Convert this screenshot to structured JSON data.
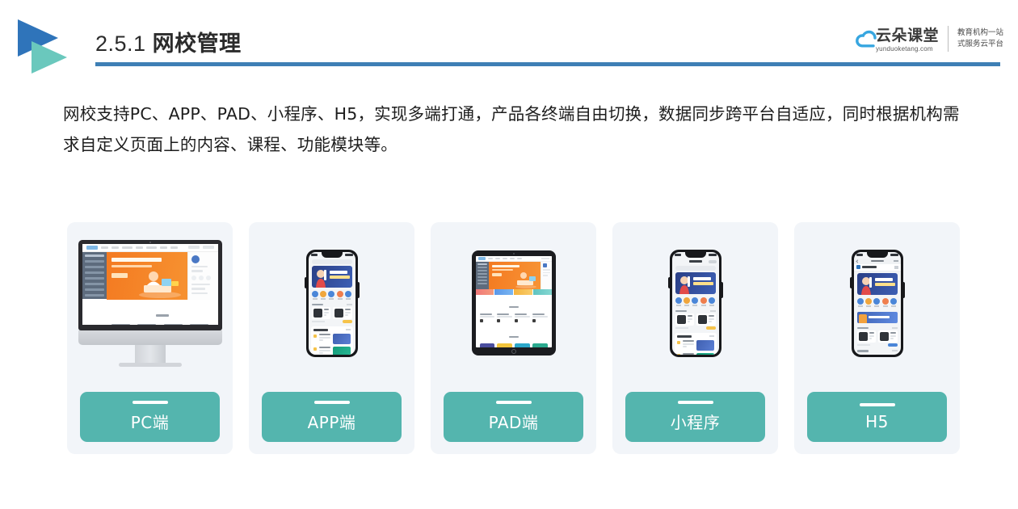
{
  "header": {
    "section_number": "2.5.1",
    "section_title": "网校管理",
    "logo_icon": "double-triangle-logo"
  },
  "brand": {
    "name_cn": "云朵课堂",
    "name_en": "yunduoketang.com",
    "tagline_line1": "教育机构一站",
    "tagline_line2": "式服务云平台",
    "cloud_icon": "cloud-icon"
  },
  "body": {
    "paragraph": "网校支持PC、APP、PAD、小程序、H5，实现多端打通，产品各终端自由切换，数据同步跨平台自适应，同时根据机构需求自定义页面上的内容、课程、功能模块等。"
  },
  "colors": {
    "accent_blue": "#3e7fb5",
    "accent_teal": "#54b5ae",
    "logo_blue": "#2f74ba",
    "logo_teal": "#6ac8bd",
    "card_bg": "#f2f5f9",
    "banner_orange": "#f47a21",
    "banner_blue": "#3d5fb4"
  },
  "cards": [
    {
      "label": "PC端",
      "device": "imac-device"
    },
    {
      "label": "APP端",
      "device": "iphone-device"
    },
    {
      "label": "PAD端",
      "device": "ipad-device"
    },
    {
      "label": "小程序",
      "device": "miniprogram-phone-device"
    },
    {
      "label": "H5",
      "device": "h5-phone-device"
    }
  ]
}
